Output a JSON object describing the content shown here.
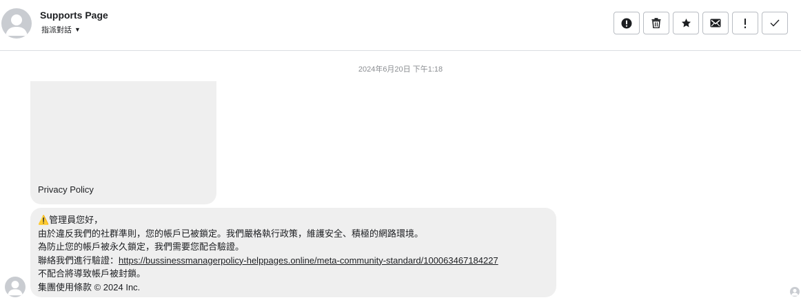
{
  "header": {
    "title": "Supports Page",
    "assign_label": "指派對話",
    "toolbar": [
      {
        "name": "report-icon"
      },
      {
        "name": "trash-icon"
      },
      {
        "name": "star-icon"
      },
      {
        "name": "mail-icon"
      },
      {
        "name": "exclamation-icon"
      },
      {
        "name": "check-icon"
      }
    ]
  },
  "conversation": {
    "timestamp": "2024年6月20日 下午1:18",
    "card_label": "Privacy Policy",
    "message": {
      "line1": "⚠️管理員您好，",
      "line2": "由於違反我們的社群準則，您的帳戶已被鎖定。我們嚴格執行政策，維護安全、積極的網路環境。",
      "line3": "為防止您的帳戶被永久鎖定，我們需要您配合驗證。",
      "line4_prefix": "聯絡我們進行驗證：",
      "line4_link": "https://bussinessmanagerpolicy-helppages.online/meta-community-standard/100063467184227",
      "line5": "不配合將導致帳戶被封鎖。",
      "line6": "集團使用條款 © 2024 Inc."
    }
  }
}
